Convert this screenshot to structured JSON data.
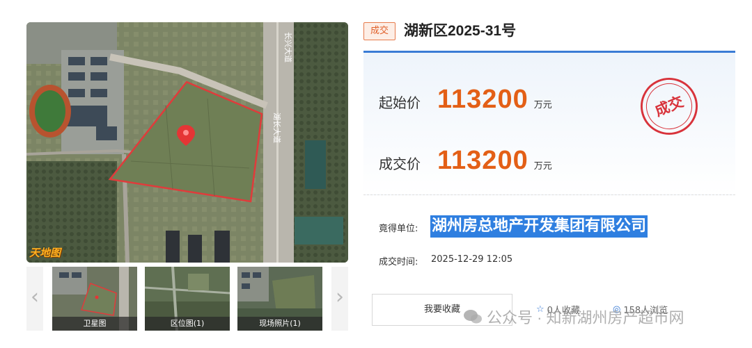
{
  "gallery": {
    "map_watermark": "天地图",
    "thumbnails": [
      {
        "caption": "卫星图"
      },
      {
        "caption": "区位图(1)"
      },
      {
        "caption": "现场照片(1)"
      }
    ],
    "prev_arrow": "‹",
    "next_arrow": "›",
    "road_labels": [
      "长兴大道",
      "湖长大道"
    ]
  },
  "lot": {
    "status_tag": "成交",
    "title": "湖新区2025-31号"
  },
  "prices": {
    "start_label": "起始价",
    "start_value": "113200",
    "start_unit": "万元",
    "deal_label": "成交价",
    "deal_value": "113200",
    "deal_unit": "万元",
    "seal_text": "成交"
  },
  "winner": {
    "label": "竟得单位:",
    "name": "湖州房总地产开发集团有限公司"
  },
  "deal_time": {
    "label": "成交时间:",
    "value": "2025-12-29 12:05"
  },
  "actions": {
    "favorite_label": "我要收藏",
    "likes": "0人收藏",
    "views": "158人浏览"
  },
  "overlay_watermark": "公众号 · 知新湖州房产超市网",
  "colors": {
    "accent_blue": "#3a7bd5",
    "price_orange": "#e35f16",
    "seal_red": "#d8333b",
    "highlight_blue": "#2f7fe0"
  }
}
